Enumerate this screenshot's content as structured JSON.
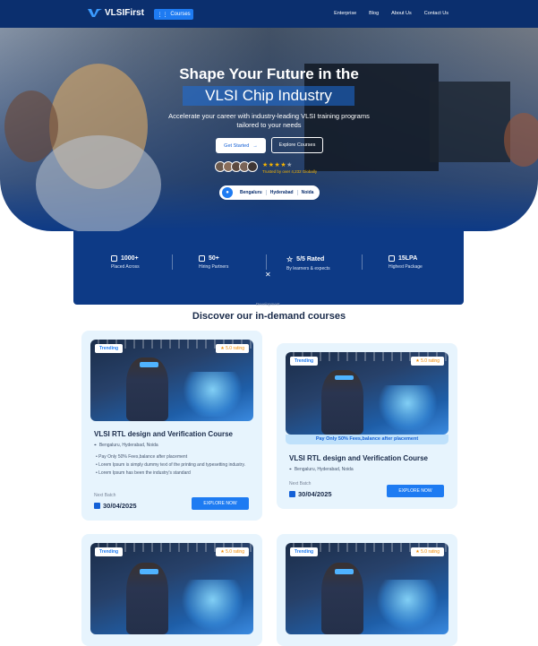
{
  "nav": {
    "logo": "VLSIFirst",
    "courses_button": "Courses",
    "links": [
      "Enterprise",
      "Blog",
      "About Us",
      "Contact Us"
    ]
  },
  "hero": {
    "title_line1": "Shape Your Future in the",
    "title_line2": "VLSI Chip Industry",
    "subtitle": "Accelerate your career with industry-leading VLSI training programs tailored to your needs",
    "get_started": "Get Started",
    "explore_courses": "Explore Courses",
    "rating_stars": 4,
    "trusted_text": "Trusted by over 4,232 Globally",
    "locations": [
      "Bengaluru",
      "Hyderabad",
      "Noida"
    ]
  },
  "stats": [
    {
      "value": "1000+",
      "label": "Placed Across",
      "icon": "briefcase-icon"
    },
    {
      "value": "50+",
      "label": "Hiring Partners",
      "icon": "handshake-icon"
    },
    {
      "value": "5/5 Rated",
      "label": "By learners & expects",
      "icon": "star-icon"
    },
    {
      "value": "15LPA",
      "label": "Highest Package",
      "icon": "money-icon"
    }
  ],
  "corner_text": "Development",
  "courses_section": {
    "title": "Discover our in-demand courses",
    "cards": [
      {
        "tag": "Trending",
        "rating": "5.0 rating",
        "title": "VLSI RTL design and Verification Course",
        "locations": "Bengaluru, Hyderabad, Noida",
        "bullets": [
          "Pay Only 50% Fees,balance after placement",
          "Lorem Ipsum is simply dummy text of the printing and typesetting industry.",
          "Lorem Ipsum has been the industry's standard"
        ],
        "next_batch_label": "Next Batch",
        "next_batch_date": "30/04/2025",
        "button": "EXPLORE NOW"
      },
      {
        "tag": "Trending",
        "rating": "5.0 rating",
        "promo": "Pay Only 50% Fees,balance after placement",
        "title": "VLSI RTL design and Verification Course",
        "locations": "Bengaluru, Hyderabad, Noida",
        "next_batch_label": "Next Batch",
        "next_batch_date": "30/04/2025",
        "button": "EXPLORE NOW"
      },
      {
        "tag": "Trending",
        "rating": "5.0 rating"
      },
      {
        "tag": "Trending",
        "rating": "5.0 rating"
      }
    ]
  }
}
